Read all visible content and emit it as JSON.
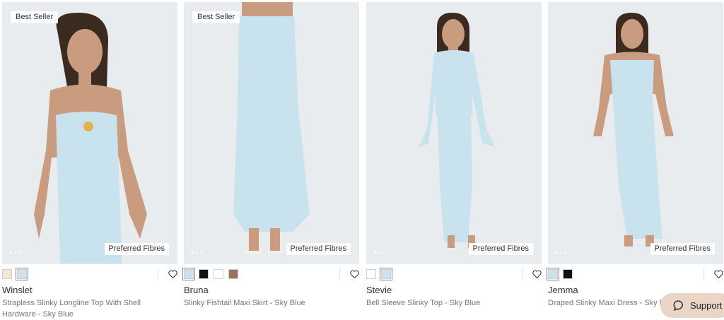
{
  "products": [
    {
      "badge": "Best Seller",
      "fibres_tag": "Preferred Fibres",
      "name": "Winslet",
      "description": "Strapless Slinky Longline Top With Shell Hardware - Sky Blue",
      "swatches": [
        "#f1e6d8",
        "#cfe1ea"
      ],
      "selected_swatch": 1,
      "image_dots": 3
    },
    {
      "badge": "Best Seller",
      "fibres_tag": "Preferred Fibres",
      "name": "Bruna",
      "description": "Slinky Fishtail Maxi Skirt - Sky Blue",
      "swatches": [
        "#cfe1ea",
        "#111111",
        "#ffffff",
        "#9a7260"
      ],
      "selected_swatch": 0,
      "image_dots": 3
    },
    {
      "badge": "",
      "fibres_tag": "Preferred Fibres",
      "name": "Stevie",
      "description": "Bell Sleeve Slinky Top - Sky Blue",
      "swatches": [
        "#ffffff",
        "#cfe1ea"
      ],
      "selected_swatch": 1,
      "image_dots": 3
    },
    {
      "badge": "",
      "fibres_tag": "Preferred Fibres",
      "name": "Jemma",
      "description": "Draped Slinky Maxi Dress - Sky Blue",
      "swatches": [
        "#cfe1ea",
        "#111111"
      ],
      "selected_swatch": 0,
      "image_dots": 3
    }
  ],
  "support": {
    "label": "Support"
  },
  "colors": {
    "garment": "#c9e3ee",
    "skin": "#c99c80",
    "hair": "#3a2a20",
    "backdrop": "#e9ecee"
  }
}
